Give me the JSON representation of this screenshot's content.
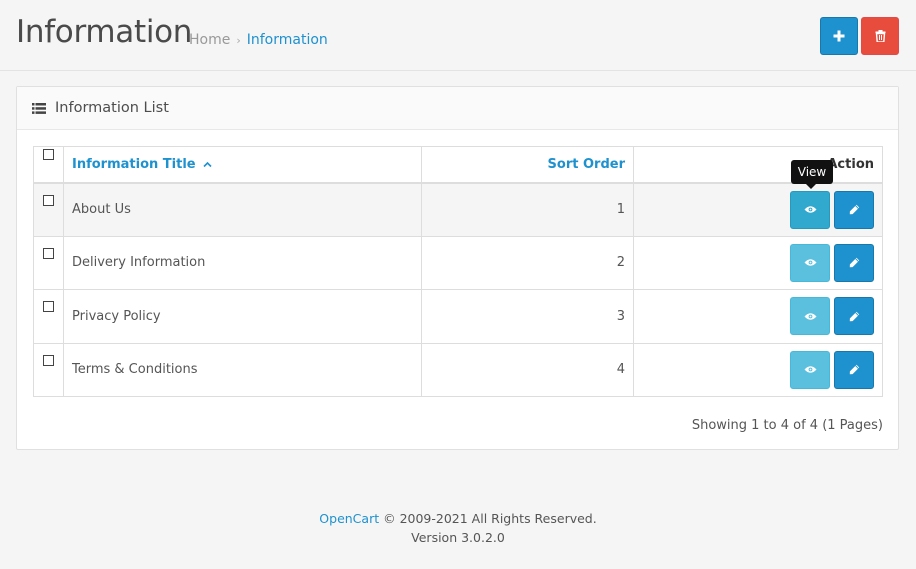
{
  "header": {
    "title": "Information",
    "breadcrumb": {
      "home": "Home",
      "separator": "›",
      "current": "Information"
    },
    "add_icon": "plus-icon",
    "delete_icon": "trash-icon"
  },
  "panel": {
    "icon": "list-icon",
    "title": "Information List"
  },
  "table": {
    "columns": {
      "title": "Information Title",
      "sort_order": "Sort Order",
      "action": "Action"
    },
    "rows": [
      {
        "title": "About Us",
        "sort_order": "1"
      },
      {
        "title": "Delivery Information",
        "sort_order": "2"
      },
      {
        "title": "Privacy Policy",
        "sort_order": "3"
      },
      {
        "title": "Terms & Conditions",
        "sort_order": "4"
      }
    ],
    "tooltip": "View"
  },
  "results": "Showing 1 to 4 of 4 (1 Pages)",
  "footer": {
    "brand": "OpenCart",
    "copyright": " © 2009-2021 All Rights Reserved.",
    "version": "Version 3.0.2.0"
  },
  "colors": {
    "primary": "#1e91cf",
    "info": "#5bc0de",
    "danger": "#e74c3c"
  }
}
